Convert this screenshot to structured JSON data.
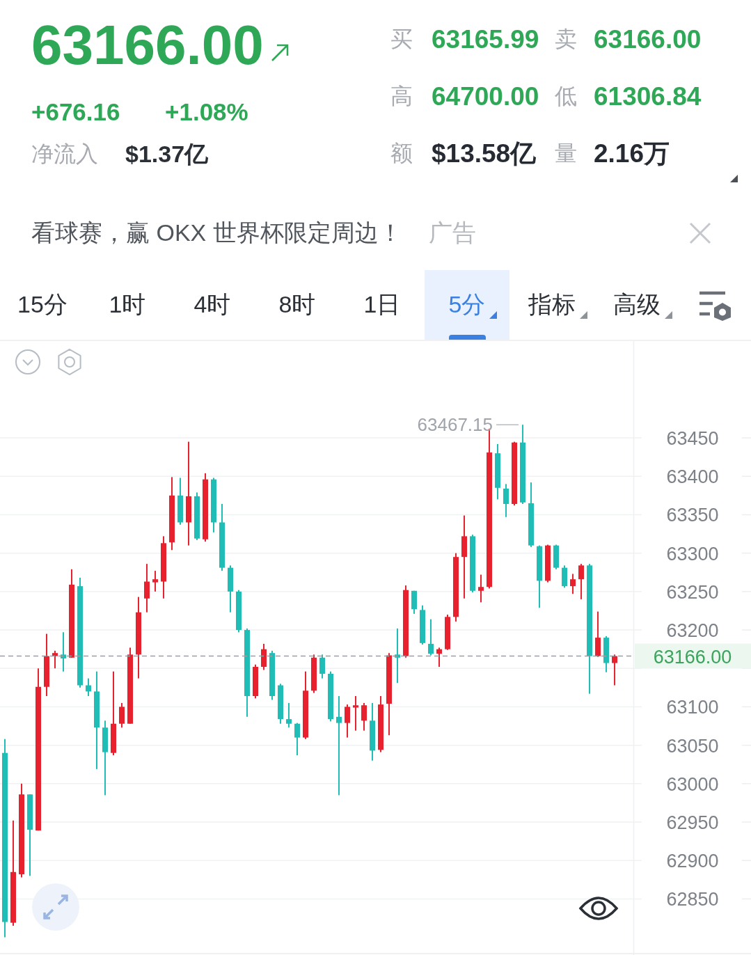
{
  "quote": {
    "price": "63166.00",
    "rising": true,
    "change": "+676.16",
    "change_percent": "+1.08%",
    "net_inflow_label": "净流入",
    "net_inflow": "$1.37亿"
  },
  "stats": [
    {
      "label": "买",
      "value": "63165.99",
      "kind": "price"
    },
    {
      "label": "卖",
      "value": "63166.00",
      "kind": "price"
    },
    {
      "label": "高",
      "value": "64700.00",
      "kind": "price"
    },
    {
      "label": "低",
      "value": "61306.84",
      "kind": "price"
    },
    {
      "label": "额",
      "value": "$13.58亿",
      "kind": "amount"
    },
    {
      "label": "量",
      "value": "2.16万",
      "kind": "amount"
    }
  ],
  "ad": {
    "text": "看球赛，赢 OKX 世界杯限定周边！",
    "tag": "广告"
  },
  "tabs": [
    {
      "label": "15分",
      "selected": false,
      "dropdown": false
    },
    {
      "label": "1时",
      "selected": false,
      "dropdown": false
    },
    {
      "label": "4时",
      "selected": false,
      "dropdown": false
    },
    {
      "label": "8时",
      "selected": false,
      "dropdown": false
    },
    {
      "label": "1日",
      "selected": false,
      "dropdown": false
    },
    {
      "label": "5分",
      "selected": true,
      "dropdown": true
    },
    {
      "label": "指标",
      "selected": false,
      "dropdown": true
    },
    {
      "label": "高级",
      "selected": false,
      "dropdown": true
    }
  ],
  "chart": {
    "chart_data": {
      "type": "candlestick",
      "categories": [
        null,
        null,
        null,
        null,
        null,
        null,
        null,
        null,
        null,
        null,
        null,
        null,
        null,
        null,
        null,
        null,
        null,
        null,
        null,
        null,
        null,
        null,
        null,
        null,
        null,
        null,
        null,
        null,
        null,
        null,
        null,
        null,
        null,
        null,
        null,
        null,
        null,
        null,
        null,
        null,
        null,
        null,
        null,
        null,
        null,
        null,
        null,
        null,
        null,
        null,
        null,
        null,
        null,
        null,
        null,
        null,
        null,
        null,
        null,
        null,
        null,
        null,
        null,
        null,
        null,
        null,
        null,
        null,
        null,
        null,
        null,
        null,
        null,
        null
      ],
      "ohlc": [
        [
          63040,
          63058,
          62800,
          62820
        ],
        [
          62819,
          62952,
          62815,
          62885
        ],
        [
          62882,
          63000,
          62878,
          62986
        ],
        [
          62986,
          62986,
          62880,
          62940
        ],
        [
          62939,
          63150,
          62939,
          63126
        ],
        [
          63126,
          63195,
          63114,
          63166
        ],
        [
          63166,
          63173,
          63150,
          63170
        ],
        [
          63168,
          63197,
          63146,
          63163
        ],
        [
          63164,
          63279,
          63164,
          63259
        ],
        [
          63257,
          63268,
          63125,
          63128
        ],
        [
          63128,
          63137,
          63114,
          63120
        ],
        [
          63120,
          63146,
          63019,
          63073
        ],
        [
          63073,
          63082,
          62985,
          63041
        ],
        [
          63040,
          63146,
          63037,
          63078
        ],
        [
          63078,
          63105,
          63073,
          63100
        ],
        [
          63078,
          63177,
          63078,
          63168
        ],
        [
          63168,
          63243,
          63137,
          63223
        ],
        [
          63241,
          63286,
          63223,
          63263
        ],
        [
          63262,
          63277,
          63250,
          63266
        ],
        [
          63263,
          63322,
          63241,
          63313
        ],
        [
          63314,
          63399,
          63304,
          63375
        ],
        [
          63375,
          63398,
          63337,
          63340
        ],
        [
          63340,
          63445,
          63310,
          63374
        ],
        [
          63374,
          63379,
          63317,
          63319
        ],
        [
          63318,
          63404,
          63315,
          63396
        ],
        [
          63396,
          63398,
          63327,
          63340
        ],
        [
          63340,
          63364,
          63277,
          63281
        ],
        [
          63281,
          63284,
          63223,
          63250
        ],
        [
          63250,
          63252,
          63197,
          63200
        ],
        [
          63200,
          63202,
          63087,
          63114
        ],
        [
          63114,
          63155,
          63111,
          63152
        ],
        [
          63152,
          63182,
          63148,
          63175
        ],
        [
          63170,
          63173,
          63109,
          63114
        ],
        [
          63128,
          63130,
          63078,
          63084
        ],
        [
          63084,
          63105,
          63073,
          63078
        ],
        [
          63078,
          63079,
          63037,
          63060
        ],
        [
          63060,
          63146,
          63058,
          63121
        ],
        [
          63121,
          63168,
          63118,
          63164
        ],
        [
          63164,
          63168,
          63137,
          63143
        ],
        [
          63143,
          63146,
          63081,
          63084
        ],
        [
          63087,
          63114,
          62985,
          63079
        ],
        [
          63079,
          63103,
          63060,
          63100
        ],
        [
          63099,
          63114,
          63069,
          63102
        ],
        [
          63082,
          63105,
          63069,
          63102
        ],
        [
          63082,
          63105,
          63030,
          63043
        ],
        [
          63044,
          63114,
          63041,
          63103
        ],
        [
          63104,
          63170,
          63063,
          63167
        ],
        [
          63168,
          63202,
          63131,
          63164
        ],
        [
          63166,
          63258,
          63164,
          63252
        ],
        [
          63251,
          63251,
          63221,
          63227
        ],
        [
          63226,
          63232,
          63181,
          63183
        ],
        [
          63182,
          63214,
          63167,
          63169
        ],
        [
          63169,
          63177,
          63152,
          63175
        ],
        [
          63175,
          63220,
          63174,
          63217
        ],
        [
          63217,
          63300,
          63211,
          63295
        ],
        [
          63295,
          63349,
          63241,
          63322
        ],
        [
          63322,
          63324,
          63249,
          63251
        ],
        [
          63251,
          63272,
          63236,
          63256
        ],
        [
          63256,
          63462,
          63254,
          63431
        ],
        [
          63430,
          63442,
          63370,
          63385
        ],
        [
          63384,
          63390,
          63347,
          63364
        ],
        [
          63364,
          63445,
          63362,
          63444
        ],
        [
          63444,
          63467.15,
          63364,
          63366
        ],
        [
          63365,
          63392,
          63308,
          63310
        ],
        [
          63309,
          63310,
          63229,
          63264
        ],
        [
          63264,
          63311,
          63262,
          63310
        ],
        [
          63310,
          63311,
          63279,
          63281
        ],
        [
          63281,
          63284,
          63255,
          63257
        ],
        [
          63257,
          63273,
          63247,
          63266
        ],
        [
          63266,
          63286,
          63240,
          63284
        ],
        [
          63284,
          63286,
          63117,
          63166
        ],
        [
          63166,
          63224,
          63165,
          63190
        ],
        [
          63190,
          63192,
          63145,
          63157
        ],
        [
          63157,
          63168,
          63128,
          63166
        ]
      ],
      "ylim": [
        62777,
        63576
      ],
      "yticks": [
        62850,
        62900,
        62950,
        63000,
        63050,
        63100,
        63200,
        63250,
        63300,
        63350,
        63400,
        63450
      ],
      "grid": true,
      "annotations": [
        "63467.15"
      ],
      "ref_lines": [
        {
          "axis": "y",
          "value": 63166,
          "label": "63166.00"
        }
      ]
    }
  }
}
